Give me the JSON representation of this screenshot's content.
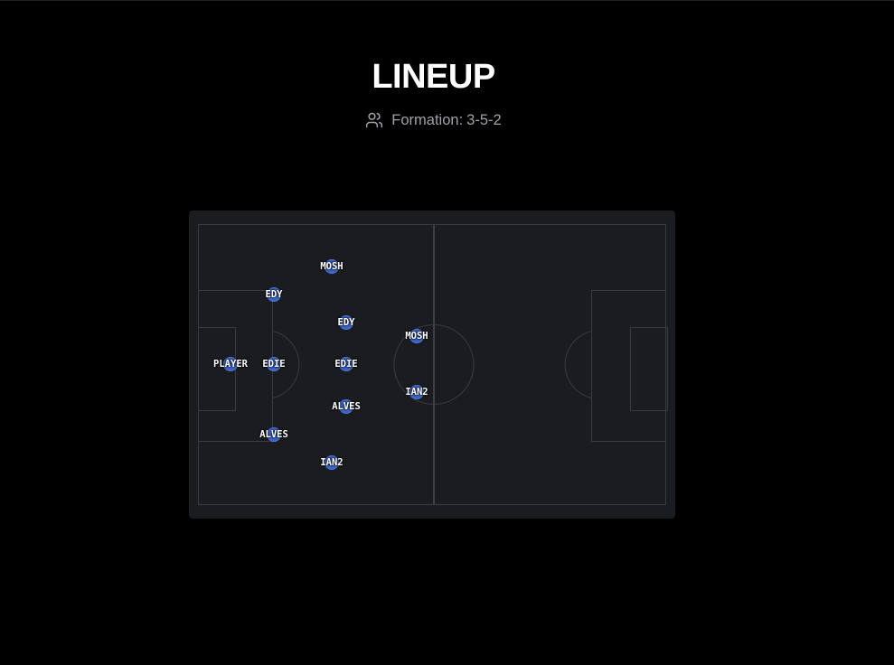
{
  "header": {
    "title": "LINEUP",
    "formation_label": "Formation:",
    "formation_value": "3-5-2"
  },
  "icons": {
    "formation": "users-icon"
  },
  "colors": {
    "background": "#000000",
    "pitch": "#1b1c20",
    "pitch_lines": "#3a3b42",
    "player_dot": "#3d63c6",
    "muted_text": "#a1a1aa"
  },
  "players": [
    {
      "name": "PLAYER"
    },
    {
      "name": "EDY"
    },
    {
      "name": "EDIE"
    },
    {
      "name": "ALVES"
    },
    {
      "name": "MOSH"
    },
    {
      "name": "EDY"
    },
    {
      "name": "EDIE"
    },
    {
      "name": "ALVES"
    },
    {
      "name": "IAN2"
    },
    {
      "name": "MOSH"
    },
    {
      "name": "IAN2"
    }
  ]
}
